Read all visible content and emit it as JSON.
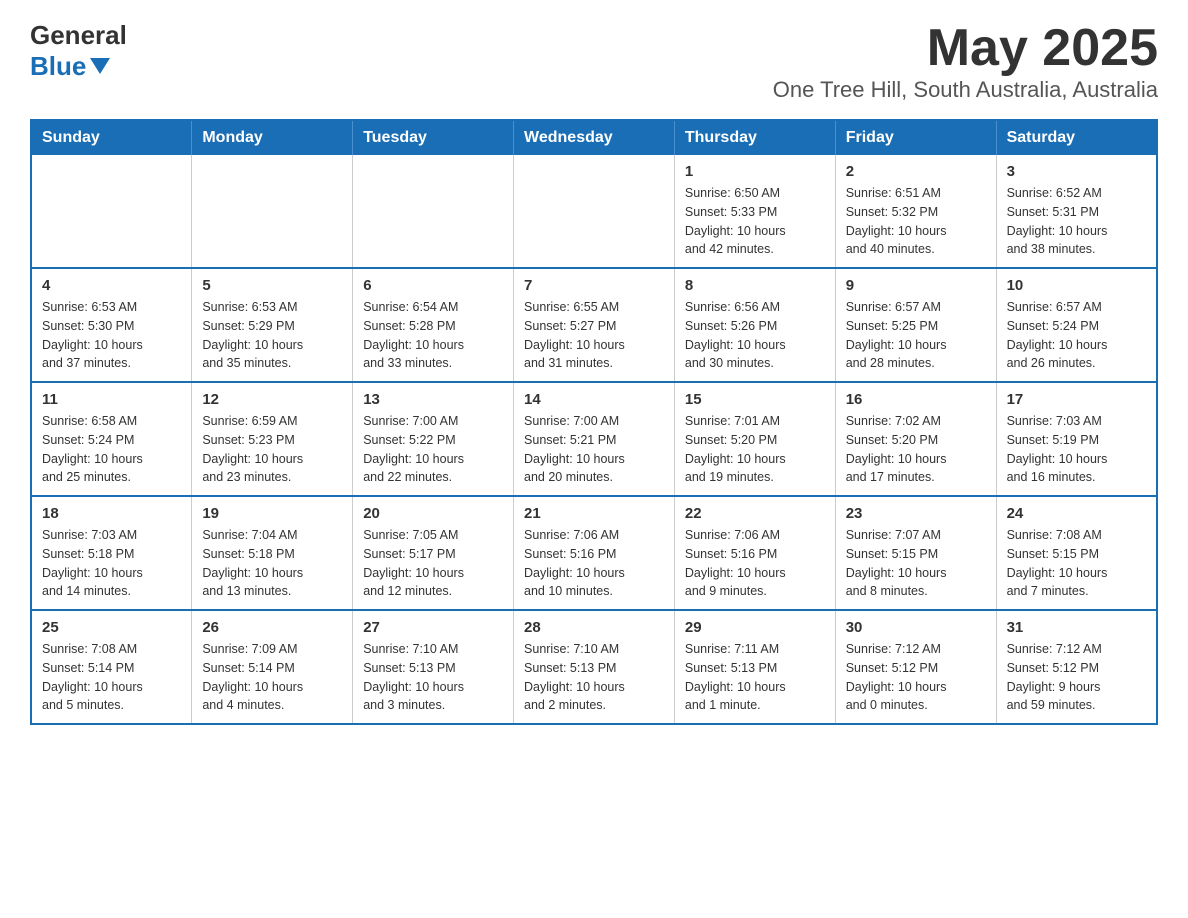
{
  "header": {
    "logo_line1": "General",
    "logo_line2": "Blue",
    "title": "May 2025",
    "subtitle": "One Tree Hill, South Australia, Australia"
  },
  "calendar": {
    "days_of_week": [
      "Sunday",
      "Monday",
      "Tuesday",
      "Wednesday",
      "Thursday",
      "Friday",
      "Saturday"
    ],
    "weeks": [
      [
        {
          "day": "",
          "info": ""
        },
        {
          "day": "",
          "info": ""
        },
        {
          "day": "",
          "info": ""
        },
        {
          "day": "",
          "info": ""
        },
        {
          "day": "1",
          "info": "Sunrise: 6:50 AM\nSunset: 5:33 PM\nDaylight: 10 hours\nand 42 minutes."
        },
        {
          "day": "2",
          "info": "Sunrise: 6:51 AM\nSunset: 5:32 PM\nDaylight: 10 hours\nand 40 minutes."
        },
        {
          "day": "3",
          "info": "Sunrise: 6:52 AM\nSunset: 5:31 PM\nDaylight: 10 hours\nand 38 minutes."
        }
      ],
      [
        {
          "day": "4",
          "info": "Sunrise: 6:53 AM\nSunset: 5:30 PM\nDaylight: 10 hours\nand 37 minutes."
        },
        {
          "day": "5",
          "info": "Sunrise: 6:53 AM\nSunset: 5:29 PM\nDaylight: 10 hours\nand 35 minutes."
        },
        {
          "day": "6",
          "info": "Sunrise: 6:54 AM\nSunset: 5:28 PM\nDaylight: 10 hours\nand 33 minutes."
        },
        {
          "day": "7",
          "info": "Sunrise: 6:55 AM\nSunset: 5:27 PM\nDaylight: 10 hours\nand 31 minutes."
        },
        {
          "day": "8",
          "info": "Sunrise: 6:56 AM\nSunset: 5:26 PM\nDaylight: 10 hours\nand 30 minutes."
        },
        {
          "day": "9",
          "info": "Sunrise: 6:57 AM\nSunset: 5:25 PM\nDaylight: 10 hours\nand 28 minutes."
        },
        {
          "day": "10",
          "info": "Sunrise: 6:57 AM\nSunset: 5:24 PM\nDaylight: 10 hours\nand 26 minutes."
        }
      ],
      [
        {
          "day": "11",
          "info": "Sunrise: 6:58 AM\nSunset: 5:24 PM\nDaylight: 10 hours\nand 25 minutes."
        },
        {
          "day": "12",
          "info": "Sunrise: 6:59 AM\nSunset: 5:23 PM\nDaylight: 10 hours\nand 23 minutes."
        },
        {
          "day": "13",
          "info": "Sunrise: 7:00 AM\nSunset: 5:22 PM\nDaylight: 10 hours\nand 22 minutes."
        },
        {
          "day": "14",
          "info": "Sunrise: 7:00 AM\nSunset: 5:21 PM\nDaylight: 10 hours\nand 20 minutes."
        },
        {
          "day": "15",
          "info": "Sunrise: 7:01 AM\nSunset: 5:20 PM\nDaylight: 10 hours\nand 19 minutes."
        },
        {
          "day": "16",
          "info": "Sunrise: 7:02 AM\nSunset: 5:20 PM\nDaylight: 10 hours\nand 17 minutes."
        },
        {
          "day": "17",
          "info": "Sunrise: 7:03 AM\nSunset: 5:19 PM\nDaylight: 10 hours\nand 16 minutes."
        }
      ],
      [
        {
          "day": "18",
          "info": "Sunrise: 7:03 AM\nSunset: 5:18 PM\nDaylight: 10 hours\nand 14 minutes."
        },
        {
          "day": "19",
          "info": "Sunrise: 7:04 AM\nSunset: 5:18 PM\nDaylight: 10 hours\nand 13 minutes."
        },
        {
          "day": "20",
          "info": "Sunrise: 7:05 AM\nSunset: 5:17 PM\nDaylight: 10 hours\nand 12 minutes."
        },
        {
          "day": "21",
          "info": "Sunrise: 7:06 AM\nSunset: 5:16 PM\nDaylight: 10 hours\nand 10 minutes."
        },
        {
          "day": "22",
          "info": "Sunrise: 7:06 AM\nSunset: 5:16 PM\nDaylight: 10 hours\nand 9 minutes."
        },
        {
          "day": "23",
          "info": "Sunrise: 7:07 AM\nSunset: 5:15 PM\nDaylight: 10 hours\nand 8 minutes."
        },
        {
          "day": "24",
          "info": "Sunrise: 7:08 AM\nSunset: 5:15 PM\nDaylight: 10 hours\nand 7 minutes."
        }
      ],
      [
        {
          "day": "25",
          "info": "Sunrise: 7:08 AM\nSunset: 5:14 PM\nDaylight: 10 hours\nand 5 minutes."
        },
        {
          "day": "26",
          "info": "Sunrise: 7:09 AM\nSunset: 5:14 PM\nDaylight: 10 hours\nand 4 minutes."
        },
        {
          "day": "27",
          "info": "Sunrise: 7:10 AM\nSunset: 5:13 PM\nDaylight: 10 hours\nand 3 minutes."
        },
        {
          "day": "28",
          "info": "Sunrise: 7:10 AM\nSunset: 5:13 PM\nDaylight: 10 hours\nand 2 minutes."
        },
        {
          "day": "29",
          "info": "Sunrise: 7:11 AM\nSunset: 5:13 PM\nDaylight: 10 hours\nand 1 minute."
        },
        {
          "day": "30",
          "info": "Sunrise: 7:12 AM\nSunset: 5:12 PM\nDaylight: 10 hours\nand 0 minutes."
        },
        {
          "day": "31",
          "info": "Sunrise: 7:12 AM\nSunset: 5:12 PM\nDaylight: 9 hours\nand 59 minutes."
        }
      ]
    ]
  }
}
